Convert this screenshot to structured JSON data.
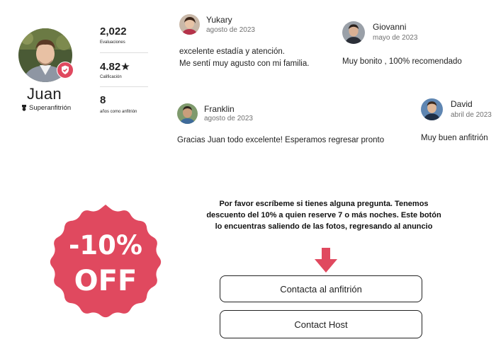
{
  "host": {
    "name": "Juan",
    "superhost_label": "Superanfitrión",
    "stats": [
      {
        "value": "2,022",
        "caption": "Evaluaciones"
      },
      {
        "value": "4.82★",
        "caption": "Calificación"
      },
      {
        "value": "8",
        "caption": "años como anfitrión"
      }
    ]
  },
  "reviews": [
    {
      "name": "Yukary",
      "date": "agosto de 2023",
      "lines": [
        "excelente estadía y atención.",
        "Me sentí muy agusto con mi familia."
      ]
    },
    {
      "name": "Giovanni",
      "date": "mayo de 2023",
      "lines": [
        "Muy bonito , 100% recomendado"
      ]
    },
    {
      "name": "Franklin",
      "date": "agosto de 2023",
      "lines": [
        "Gracias Juan todo excelente! Esperamos regresar pronto"
      ]
    },
    {
      "name": "David",
      "date": "abril de 2023",
      "lines": [
        "Muy buen anfitrión"
      ]
    }
  ],
  "promo": {
    "badge_line1": "-10%",
    "badge_line2": "OFF",
    "badge_color": "#e0495f",
    "message_lines": [
      "Por favor escríbeme si tienes alguna pregunta. Tenemos",
      "descuento del 10% a quien reserve 7 o más noches. Este botón",
      "lo encuentras saliendo de las fotos, regresando al anuncio"
    ],
    "arrow_color": "#e0495f"
  },
  "buttons": {
    "contact_es": "Contacta al anfitrión",
    "contact_en": "Contact Host"
  },
  "icons": {
    "verified": "shield-check-icon",
    "superhost": "superhost-medal-icon",
    "arrow": "arrow-down-icon"
  }
}
